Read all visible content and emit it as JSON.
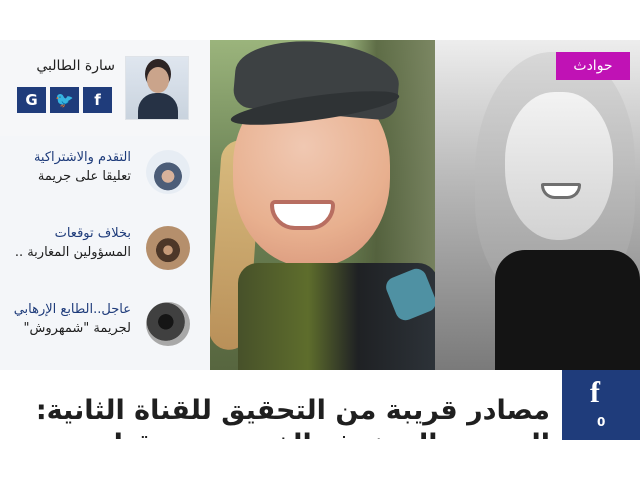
{
  "author": {
    "name": "سارة الطالبي",
    "social": {
      "google": "G",
      "twitter": "🐦",
      "facebook": "f"
    }
  },
  "related": [
    {
      "line1": "التقدم والاشتراكية",
      "line2": "تعليقا على جريمة"
    },
    {
      "line1": "بخلاف توقعات",
      "line2": "المسؤولين المغاربة .."
    },
    {
      "line1": "عاجل..الطابع الإرهابي",
      "line2": "لجريمة \"شمهروش\""
    }
  ],
  "article": {
    "category": "حوادث",
    "headline": "مصادر قريبة من التحقيق للقناة الثانية:",
    "headline_line2": "النحوض المتخوف الذي وضح مقتل اقتراح"
  },
  "share": {
    "facebook_label": "f",
    "count": "0"
  },
  "colors": {
    "brand_blue": "#1f3c7b",
    "category_purple": "#c012b5"
  }
}
